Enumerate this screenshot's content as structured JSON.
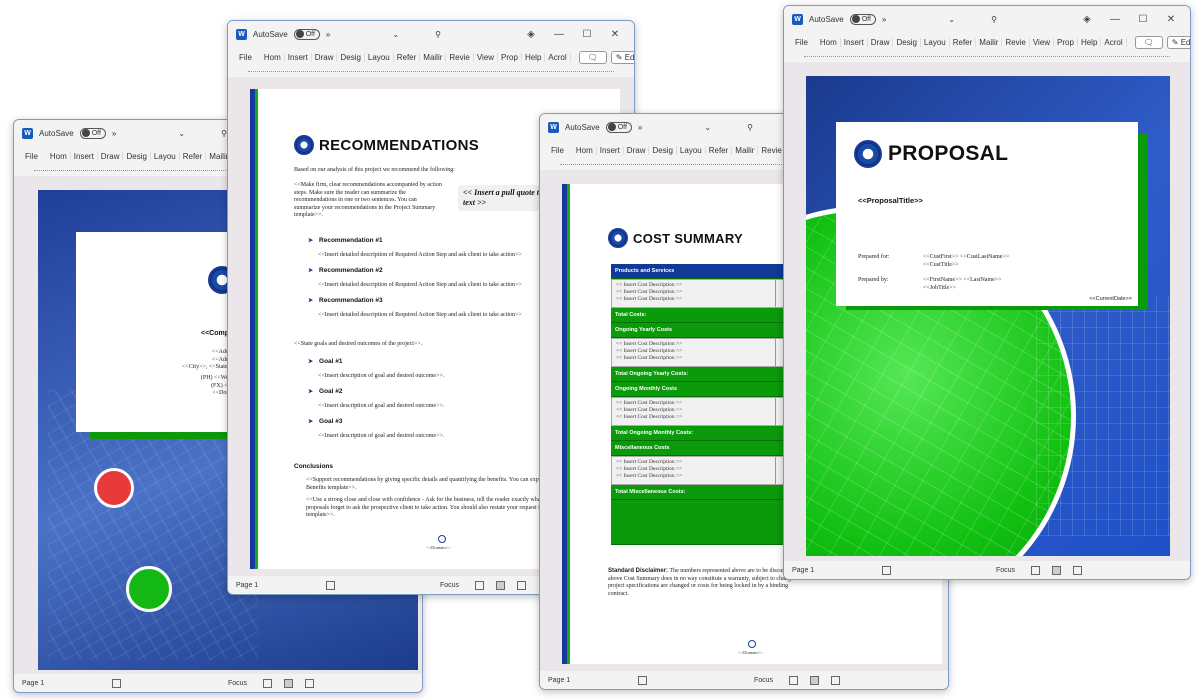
{
  "common": {
    "autosave_label": "AutoSave",
    "autosave_state": "Off",
    "more_label": "»",
    "dropdown_glyph": "⌄",
    "search_glyph": "⚲",
    "diamond_glyph": "◈",
    "minimize_glyph": "—",
    "maximize_glyph": "☐",
    "close_glyph": "✕",
    "word_icon_letter": "W",
    "menu": [
      "File",
      "Hom",
      "Insert",
      "Draw",
      "Desig",
      "Layou",
      "Refer",
      "Mailir",
      "Revie",
      "View",
      "Prop",
      "Help",
      "Acrol"
    ],
    "comment_glyph": "🗨",
    "editing_label": "✎ Editing",
    "editing_more": "›",
    "status_page": "Page 1",
    "focus_label": "Focus"
  },
  "window1": {
    "company": "<<Comp",
    "address_lines": [
      "<<Addr",
      "<<Addr",
      "<<City>>, <<State>"
    ],
    "contact_lines": [
      "(PH) <<Wor",
      "(FX) <<",
      "<<Dom"
    ]
  },
  "window2": {
    "heading": "RECOMMENDATIONS",
    "intro": "Based on our analysis of this project we recommend the following:",
    "summary": "<<Make firm, clear recommendations accompanied by action steps.  Make sure the reader can summarize the recommendations in one or two sentences.  You can summarize your recommendations in the Project Summary template>>.",
    "pull_quote": "<< Insert a pull quote that will be in emphasized text >>",
    "recommendations": [
      {
        "title": "Recommendation #1",
        "desc": "<<Insert detailed description of Required Action Step and ask client to take action>>"
      },
      {
        "title": "Recommendation #2",
        "desc": "<<Insert detailed description of Required Action Step and ask client to take action>>"
      },
      {
        "title": "Recommendation #3",
        "desc": "<<Insert detailed description of Required Action Step and ask client to take action>>"
      }
    ],
    "goals_intro": "<<State goals and desired outcomes of the project>>.",
    "goals": [
      {
        "title": "Goal #1",
        "desc": "<<Insert description of goal and desired outcome>>."
      },
      {
        "title": "Goal #2",
        "desc": "<<Insert description of goal and desired outcome>>."
      },
      {
        "title": "Goal #3",
        "desc": "<<Insert description of goal and desired outcome>>."
      }
    ],
    "conclusions_title": "Conclusions",
    "conclusion_p1": "<<Support recommendations by giving specific details and quantifying the benefits.  You can expand on the benefits by adding the Benefits template>>.",
    "conclusion_p2": "<<Use a strong close and close with confidence - Ask for the business, tell the reader exactly what you want him or her to do.  Many proposals forget to ask the prospective client to take action. You should also restate your request for action in the Project Summary template>>.",
    "footer_domain": "<<Domain>>"
  },
  "window3": {
    "heading": "COST SUMMARY",
    "sections": [
      {
        "header": "Products and Services",
        "header_color": "blue",
        "items": [
          "<< Insert Cost Description >>",
          "<< Insert Cost Description >>",
          "<< Insert Cost Description >>"
        ],
        "total": "Total Costs:"
      },
      {
        "header": "Ongoing Yearly Costs",
        "header_color": "green",
        "items": [
          "<< Insert Cost Description >>",
          "<< Insert Cost Description >>",
          "<< Insert Cost Description >>"
        ],
        "total": "Total Ongoing Yearly Costs:"
      },
      {
        "header": "Ongoing Monthly Costs",
        "header_color": "green",
        "items": [
          "<< Insert Cost Description >>",
          "<< Insert Cost Description >>",
          "<< Insert Cost Description >>"
        ],
        "total": "Total Ongoing Monthly Costs:"
      },
      {
        "header": "Miscellaneous Costs",
        "header_color": "green",
        "items": [
          "<< Insert Cost Description >>",
          "<< Insert Cost Description >>",
          "<< Insert Cost Description >>"
        ],
        "total": "Total Miscellaneous Costs:"
      }
    ],
    "disclaimer_label": "Standard Disclaimer:",
    "disclaimer_text": " The numbers represented above are to be discussed. The above Cost Summary does in no way constitute a warranty, subject to change if project specifications are changed or costs for being locked in by a binding contract.",
    "footer_domain": "<<Domain>>"
  },
  "window4": {
    "heading": "PROPOSAL",
    "title_placeholder": "<<ProposalTitle>>",
    "prepared_for_label": "Prepared for:",
    "prepared_for_lines": [
      "<<CustFirst>> <<CustLastName>>",
      "<<CustTitle>>"
    ],
    "prepared_by_label": "Prepared by:",
    "prepared_by_lines": [
      "<<FirstName>> <<LastName>>",
      "<<JobTitle>>"
    ],
    "date_placeholder": "<<CurrentDate>>"
  },
  "colors": {
    "brand_blue": "#14399a",
    "brand_green": "#0a9a0a",
    "accent_red": "#e83a3a"
  }
}
